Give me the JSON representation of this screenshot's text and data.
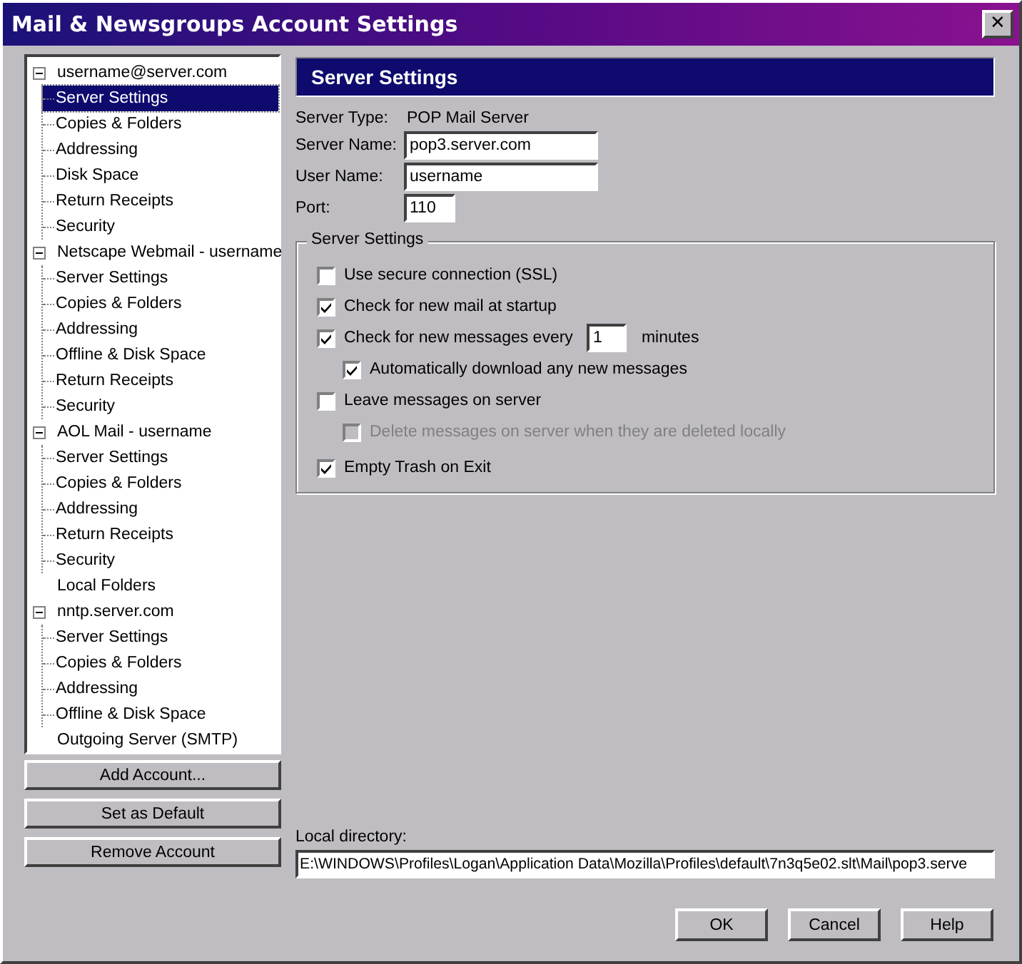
{
  "window": {
    "title": "Mail & Newsgroups Account Settings",
    "close": "✕"
  },
  "tree": [
    {
      "label": "username@server.com",
      "expanded": true,
      "selected": false,
      "children": [
        {
          "label": "Server Settings",
          "selected": true
        },
        {
          "label": "Copies & Folders",
          "selected": false
        },
        {
          "label": "Addressing",
          "selected": false
        },
        {
          "label": "Disk Space",
          "selected": false
        },
        {
          "label": "Return Receipts",
          "selected": false
        },
        {
          "label": "Security",
          "selected": false
        }
      ]
    },
    {
      "label": "Netscape Webmail - username",
      "expanded": true,
      "selected": false,
      "children": [
        {
          "label": "Server Settings",
          "selected": false
        },
        {
          "label": "Copies & Folders",
          "selected": false
        },
        {
          "label": "Addressing",
          "selected": false
        },
        {
          "label": "Offline & Disk Space",
          "selected": false
        },
        {
          "label": "Return Receipts",
          "selected": false
        },
        {
          "label": "Security",
          "selected": false
        }
      ]
    },
    {
      "label": "AOL Mail - username",
      "expanded": true,
      "selected": false,
      "children": [
        {
          "label": "Server Settings",
          "selected": false
        },
        {
          "label": "Copies & Folders",
          "selected": false
        },
        {
          "label": "Addressing",
          "selected": false
        },
        {
          "label": "Return Receipts",
          "selected": false
        },
        {
          "label": "Security",
          "selected": false
        }
      ]
    },
    {
      "label": "Local Folders",
      "selected": false
    },
    {
      "label": "nntp.server.com",
      "expanded": true,
      "selected": false,
      "children": [
        {
          "label": "Server Settings",
          "selected": false
        },
        {
          "label": "Copies & Folders",
          "selected": false
        },
        {
          "label": "Addressing",
          "selected": false
        },
        {
          "label": "Offline & Disk Space",
          "selected": false
        }
      ]
    },
    {
      "label": "Outgoing Server (SMTP)",
      "selected": false
    }
  ],
  "account_buttons": [
    "Add Account...",
    "Set as Default",
    "Remove Account"
  ],
  "panel_title": "Server Settings",
  "server_type": {
    "label": "Server Type:",
    "value": "POP Mail Server"
  },
  "fields": [
    {
      "label": "Server Name:",
      "value": "pop3.server.com"
    },
    {
      "label": "User Name:",
      "value": "username"
    },
    {
      "label": "Port:",
      "value": "110"
    }
  ],
  "group": {
    "title": "Server Settings",
    "options": [
      {
        "label": "Use secure connection (SSL)",
        "checked": false,
        "disabled": false
      },
      {
        "label": "Check for new mail at startup",
        "checked": true,
        "disabled": false
      },
      {
        "label": "Check for new messages every",
        "checked": true,
        "disabled": false,
        "interval": {
          "value": "1",
          "unit": "minutes"
        },
        "children": [
          {
            "label": "Automatically download any new messages",
            "checked": true,
            "disabled": false
          }
        ]
      },
      {
        "label": "Leave messages on server",
        "checked": false,
        "disabled": false,
        "children": [
          {
            "label": "Delete messages on server when they are deleted locally",
            "checked": false,
            "disabled": true
          }
        ]
      },
      {
        "label": "Empty Trash on Exit",
        "checked": true,
        "disabled": false
      }
    ]
  },
  "local_directory": {
    "label": "Local directory:",
    "value": "E:\\WINDOWS\\Profiles\\Logan\\Application Data\\Mozilla\\Profiles\\default\\7n3q5e02.slt\\Mail\\pop3.serve"
  },
  "dialog_buttons": [
    "OK",
    "Cancel",
    "Help"
  ]
}
